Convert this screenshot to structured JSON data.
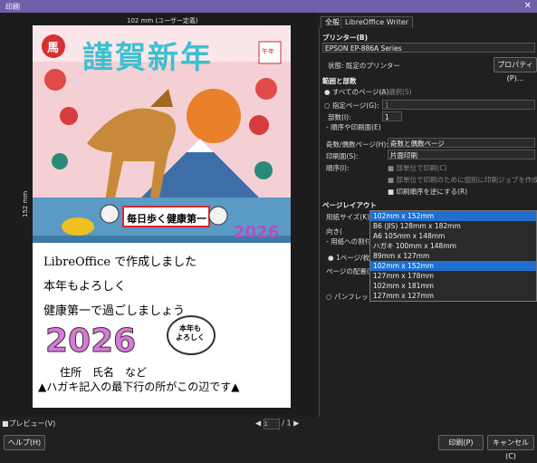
{
  "window": {
    "title": "印刷",
    "close": "✕"
  },
  "preview": {
    "paper_size_label": "102 mm (ユーザー定義)",
    "paper_height_label": "152 mm",
    "card": {
      "headline": "謹賀新年",
      "uma_stamp": "馬",
      "seal": "午年",
      "banner": "毎日歩く健康第一",
      "year_small": "2026",
      "line1": "LibreOffice で作成しました",
      "line2": "本年もよろしく",
      "line3": "健康第一で過ごしましょう",
      "year_big": "2026",
      "bubble": "本年も\nよろしく",
      "address": "住所　氏名　など",
      "bottom_note": "▲ハガキ記入の最下行の所がこの辺です▲"
    },
    "checkbox_preview": "プレビュー(V)",
    "page_current": "1",
    "page_total": "/ 1"
  },
  "tabs": [
    "全般",
    "LibreOffice Writer"
  ],
  "printer": {
    "section": "プリンター(B)",
    "name": "EPSON EP-886A Series",
    "status_label": "状態: 既定のプリンター",
    "properties_button": "プロパティ(P)..."
  },
  "range": {
    "section": "範囲と部数",
    "all_pages": "すべてのページ(A)",
    "selection": "選択(S)",
    "pages_label": "指定ページ(G):",
    "pages_value": "1",
    "copies_label": "部数(I):",
    "copies_value": "1",
    "reverse": "順序や印刷面(E)"
  },
  "options": {
    "odd_even_label": "奇数/偶数ページ(H):",
    "odd_even_value": "奇数と偶数ページ",
    "sides_label": "印刷面(S):",
    "sides_value": "片面印刷",
    "order_label": "順序(I):",
    "collate": "部単位で印刷(C)",
    "separate_jobs": "部単位で印刷のために個別に印刷ジョブを作成",
    "reverse_order": "印刷順序を逆にする(R)"
  },
  "layout": {
    "section": "ページレイアウト",
    "paper_size_label": "用紙サイズ(K):",
    "paper_size_value": "102mm x 152mm",
    "orientation_label": "向き(",
    "fit_label": "- 用紙への割付",
    "pages_per_sheet": "1ページ/枚(O",
    "page_arrangement": "ページの配置(",
    "pamphlet": "パンフレット(U"
  },
  "paper_options": [
    "B6 (JIS) 128mm x 182mm",
    "A6 105mm x 148mm",
    "ハガキ 100mm x 148mm",
    "89mm x 127mm",
    "102mm x 152mm",
    "127mm x 178mm",
    "102mm x 181mm",
    "127mm x 127mm"
  ],
  "buttons": {
    "help": "ヘルプ(H)",
    "print": "印刷(P)",
    "cancel": "キャンセル(C)"
  },
  "colors": {
    "accent": "#1f6fd0",
    "titlebar": "#6f5ea8"
  }
}
